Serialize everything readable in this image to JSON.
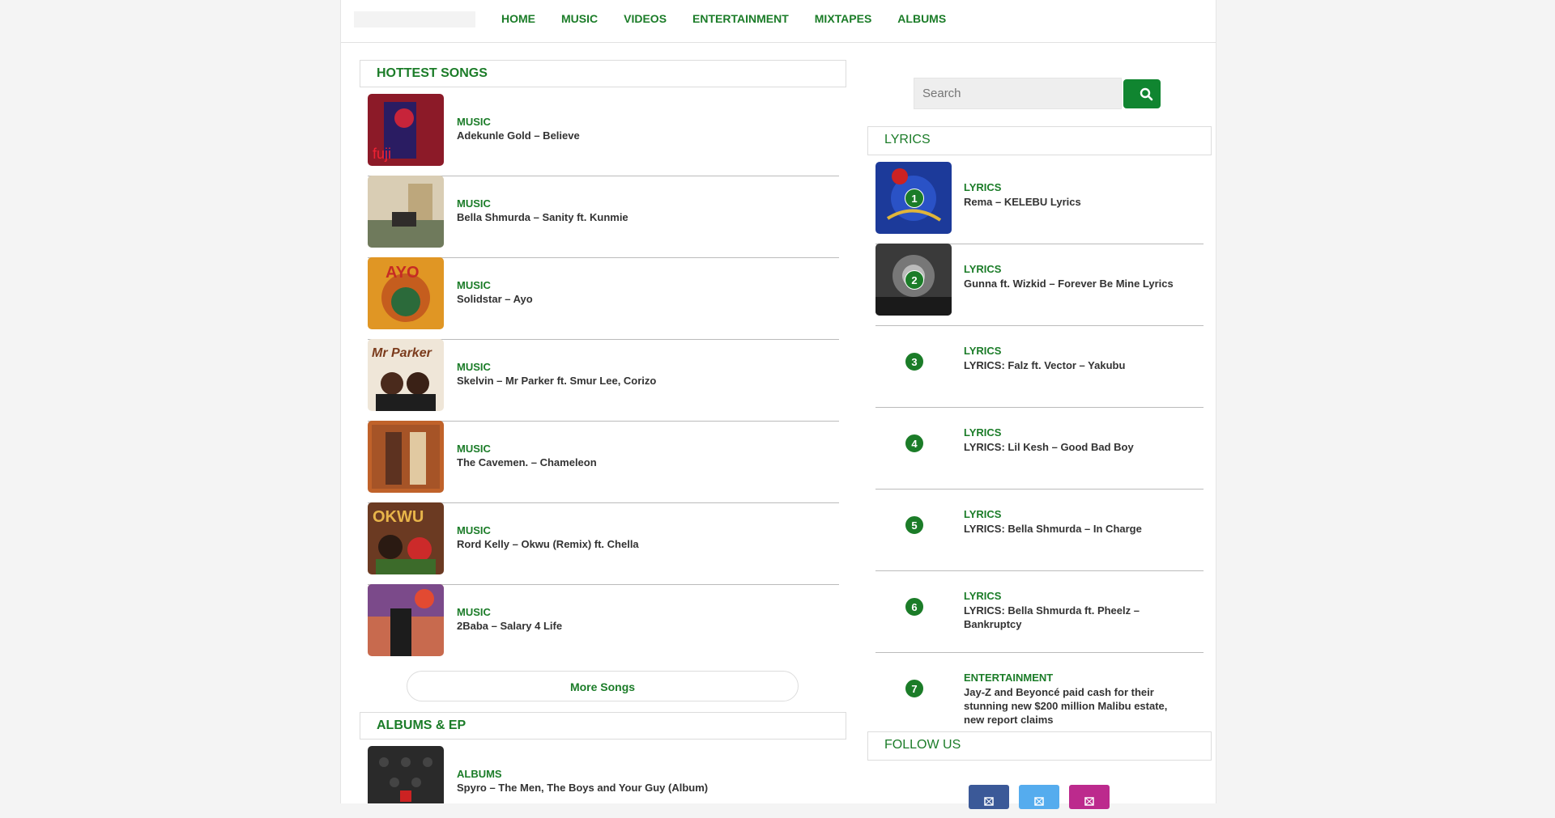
{
  "nav": {
    "items": [
      "HOME",
      "MUSIC",
      "VIDEOS",
      "ENTERTAINMENT",
      "MIXTAPES",
      "ALBUMS"
    ]
  },
  "hottest": {
    "heading": "HOTTEST SONGS",
    "songs": [
      {
        "category": "MUSIC",
        "title": "Adekunle Gold – Believe"
      },
      {
        "category": "MUSIC",
        "title": "Bella Shmurda – Sanity ft. Kunmie"
      },
      {
        "category": "MUSIC",
        "title": "Solidstar – Ayo"
      },
      {
        "category": "MUSIC",
        "title": "Skelvin – Mr Parker ft. Smur Lee, Corizo"
      },
      {
        "category": "MUSIC",
        "title": "The Cavemen. – Chameleon"
      },
      {
        "category": "MUSIC",
        "title": "Rord Kelly – Okwu (Remix) ft. Chella"
      },
      {
        "category": "MUSIC",
        "title": "2Baba – Salary 4 Life"
      }
    ],
    "more_label": "More Songs"
  },
  "albums": {
    "heading": "ALBUMS & EP",
    "items": [
      {
        "category": "ALBUMS",
        "title": "Spyro – The Men, The Boys and Your Guy (Album)"
      }
    ]
  },
  "search": {
    "placeholder": "Search"
  },
  "lyrics": {
    "heading": "LYRICS",
    "items": [
      {
        "num": "1",
        "category": "LYRICS",
        "title": "Rema – KELEBU Lyrics"
      },
      {
        "num": "2",
        "category": "LYRICS",
        "title": "Gunna ft. Wizkid – Forever Be Mine Lyrics"
      },
      {
        "num": "3",
        "category": "LYRICS",
        "title": "LYRICS: Falz ft. Vector – Yakubu"
      },
      {
        "num": "4",
        "category": "LYRICS",
        "title": "LYRICS: Lil Kesh – Good Bad Boy"
      },
      {
        "num": "5",
        "category": "LYRICS",
        "title": "LYRICS: Bella Shmurda – In Charge"
      },
      {
        "num": "6",
        "category": "LYRICS",
        "title": "LYRICS: Bella Shmurda ft. Pheelz – Bankruptcy"
      },
      {
        "num": "7",
        "category": "ENTERTAINMENT",
        "title": "Jay-Z and Beyoncé paid cash for their stunning new $200 million Malibu estate, new report claims"
      }
    ]
  },
  "follow": {
    "heading": "FOLLOW US"
  },
  "colors": {
    "accent": "#1b7c28",
    "search_button": "#108530",
    "facebook": "#3b5998",
    "twitter": "#55acee",
    "instagram": "#bc2a8d"
  }
}
